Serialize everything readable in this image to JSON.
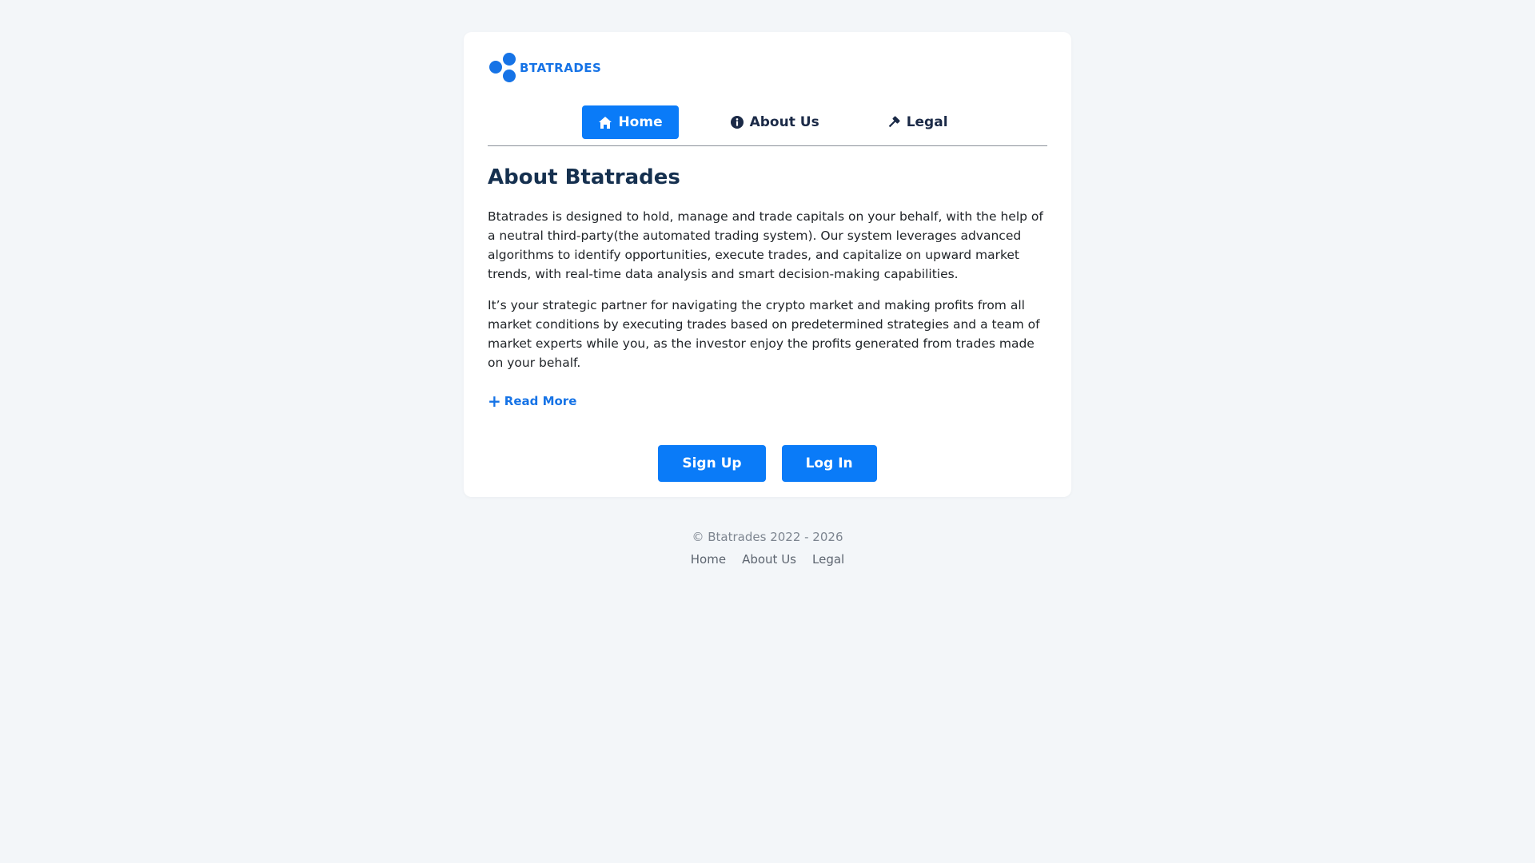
{
  "brand": {
    "name": "BTATRADES",
    "color": "#1673e6"
  },
  "nav": {
    "items": [
      {
        "label": "Home",
        "icon": "home-icon",
        "active": true
      },
      {
        "label": "About Us",
        "icon": "info-icon",
        "active": false
      },
      {
        "label": "Legal",
        "icon": "gavel-icon",
        "active": false
      }
    ]
  },
  "main": {
    "heading": "About Btatrades",
    "paragraphs": [
      "Btatrades is designed to hold, manage and trade capitals on your behalf, with the help of a neutral third-party(the automated trading system). Our system leverages advanced algorithms to identify opportunities, execute trades, and capitalize on upward market trends, with real-time data analysis and smart decision-making capabilities.",
      "It’s your strategic partner for navigating the crypto market and making profits from all market conditions by executing trades based on predetermined strategies and a team of market experts while you, as the investor enjoy the profits generated from trades made on your behalf."
    ],
    "read_more": "Read More",
    "signup_label": "Sign Up",
    "login_label": "Log In"
  },
  "footer": {
    "copyright": "© Btatrades 2022 - 2026",
    "links": [
      "Home",
      "About Us",
      "Legal"
    ]
  },
  "colors": {
    "accent": "#0a7bf8",
    "heading": "#15304f",
    "background": "#f3f6f9"
  }
}
